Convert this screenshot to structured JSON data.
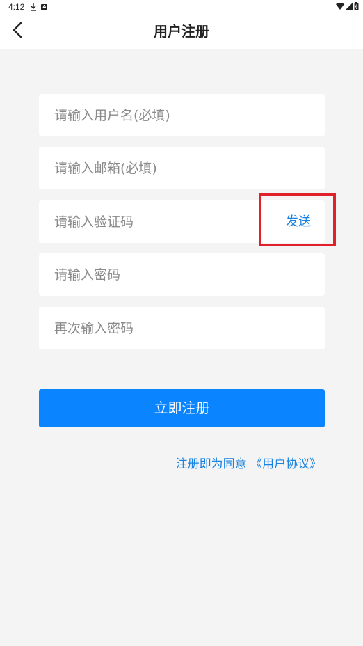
{
  "status_bar": {
    "time": "4:12",
    "icons": [
      "download-icon",
      "notification-a-icon",
      "wifi-icon",
      "signal-icon",
      "battery-icon"
    ]
  },
  "header": {
    "title": "用户注册",
    "back_icon": "chevron-left-icon"
  },
  "form": {
    "username_placeholder": "请输入用户名(必填)",
    "email_placeholder": "请输入邮箱(必填)",
    "code_placeholder": "请输入验证码",
    "send_label": "发送",
    "password_placeholder": "请输入密码",
    "confirm_password_placeholder": "再次输入密码"
  },
  "actions": {
    "register_label": "立即注册"
  },
  "agreement": {
    "prefix": "注册即为同意",
    "link": "《用户协议》"
  },
  "colors": {
    "primary": "#0a84ff",
    "link": "#1a82e0",
    "highlight": "#e0202a",
    "background": "#f4f4f4"
  }
}
